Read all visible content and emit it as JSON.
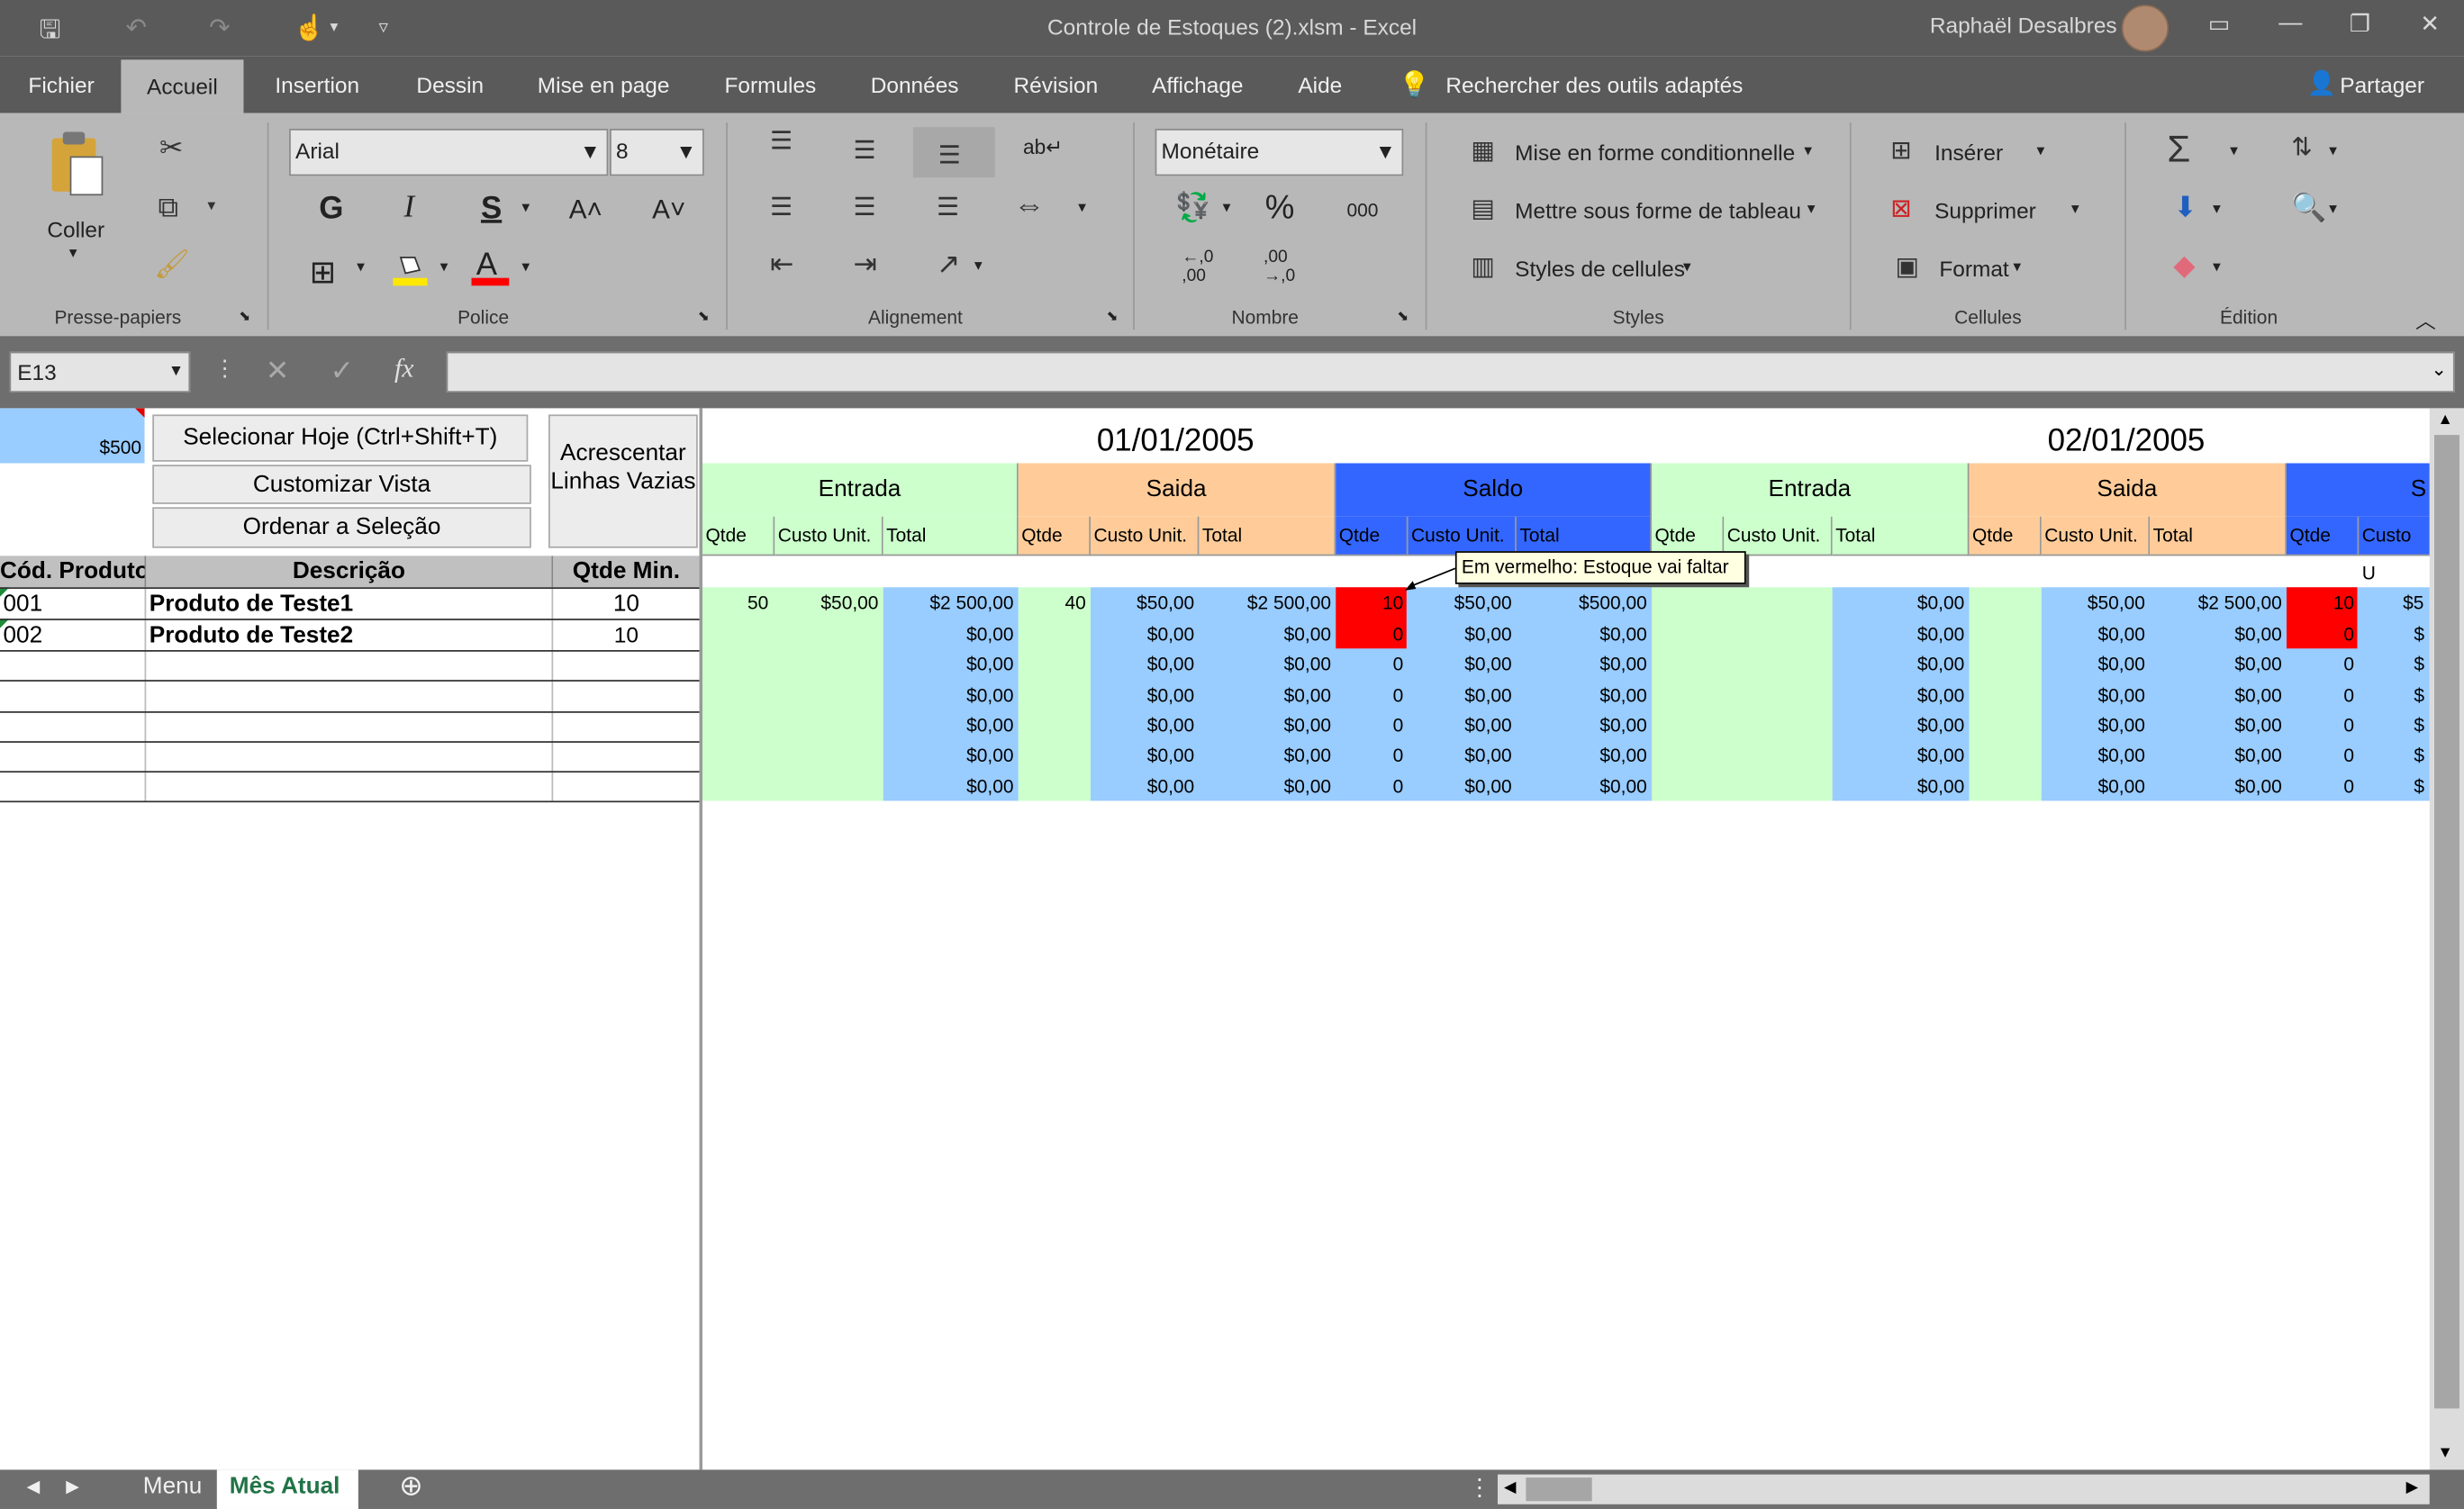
{
  "window": {
    "title": "Controle de Estoques (2).xlsm  -  Excel",
    "user": "Raphaël Desalbres",
    "colors": {
      "titlebar": "#5a5a5a",
      "ribbon": "#b8b8b8"
    }
  },
  "ribbon_tabs": [
    "Fichier",
    "Accueil",
    "Insertion",
    "Dessin",
    "Mise en page",
    "Formules",
    "Données",
    "Révision",
    "Affichage",
    "Aide"
  ],
  "active_tab": "Accueil",
  "tell_me": "Rechercher des outils adaptés",
  "share": "Partager",
  "groups": {
    "clipboard": {
      "label": "Presse-papiers",
      "paste": "Coller"
    },
    "font": {
      "label": "Police",
      "font_name": "Arial",
      "font_size": "8",
      "bold": "G",
      "italic": "I",
      "underline": "S"
    },
    "alignment": {
      "label": "Alignement"
    },
    "number": {
      "label": "Nombre",
      "format": "Monétaire",
      "percent": "%",
      "thousands": "000",
      "inc_decimal": "←,0\n,00",
      "dec_decimal": ",00\n→,0"
    },
    "styles": {
      "label": "Styles",
      "conditional": "Mise en forme conditionnelle",
      "table": "Mettre sous forme de tableau",
      "cell_styles": "Styles de cellules"
    },
    "cells": {
      "label": "Cellules",
      "insert": "Insérer",
      "delete": "Supprimer",
      "format": "Format"
    },
    "editing": {
      "label": "Édition"
    }
  },
  "formula_bar": {
    "name_box": "E13",
    "formula": "",
    "fx": "fx"
  },
  "sheet": {
    "top_cell_value": "$500",
    "buttons": {
      "select_today": "Selecionar Hoje (Ctrl+Shift+T)",
      "customize_view": "Customizar Vista",
      "sort_selection": "Ordenar a Seleção",
      "add_empty_rows": "Acrescentar Linhas Vazias"
    },
    "columns": {
      "code": "Cód. Produto",
      "description": "Descrição",
      "min_qty": "Qtde Min."
    },
    "products": [
      {
        "code": "001",
        "description": "Produto de Teste1",
        "min_qty": "10"
      },
      {
        "code": "002",
        "description": "Produto de Teste2",
        "min_qty": "10"
      }
    ],
    "dates": [
      "01/01/2005",
      "02/01/2005"
    ],
    "sections": {
      "in": "Entrada",
      "out": "Saida",
      "balance": "Saldo"
    },
    "sub_headers": {
      "qty": "Qtde",
      "unit_cost": "Custo Unit.",
      "total": "Total"
    },
    "sub_header_cut": "Custo U",
    "section_cut": "S",
    "tooltip": "Em vermelho: Estoque vai faltar",
    "day1_row1": {
      "in_qty": "50",
      "in_cost": "$50,00",
      "in_total": "$2 500,00",
      "out_qty": "40",
      "out_cost": "$50,00",
      "out_total": "$2 500,00",
      "bal_qty": "10",
      "bal_cost": "$50,00",
      "bal_total": "$500,00"
    },
    "day2_row1": {
      "in_total": "$0,00",
      "out_cost": "$50,00",
      "out_total": "$2 500,00",
      "bal_qty": "10",
      "bal_cost_cut": "$5"
    },
    "zero_money": "$0,00",
    "zero_qty": "0",
    "cut_money": "$"
  },
  "sheet_tabs": [
    "Menu",
    "Mês Atual"
  ],
  "active_sheet": "Mês Atual"
}
